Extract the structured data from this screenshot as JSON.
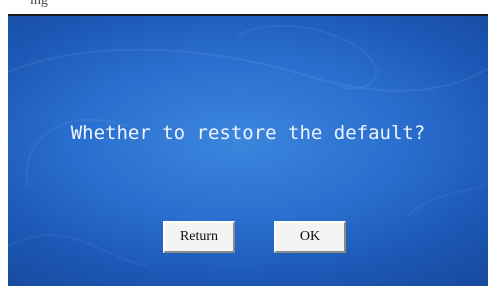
{
  "caption": {
    "partial_text": "ing"
  },
  "dialog": {
    "message": "Whether to restore the default?",
    "buttons": {
      "return_label": "Return",
      "ok_label": "OK"
    },
    "colors": {
      "background_center": "#3c86dd",
      "background_edge": "#144493",
      "text": "#eef4ff",
      "button_face": "#f4f4f4"
    }
  }
}
